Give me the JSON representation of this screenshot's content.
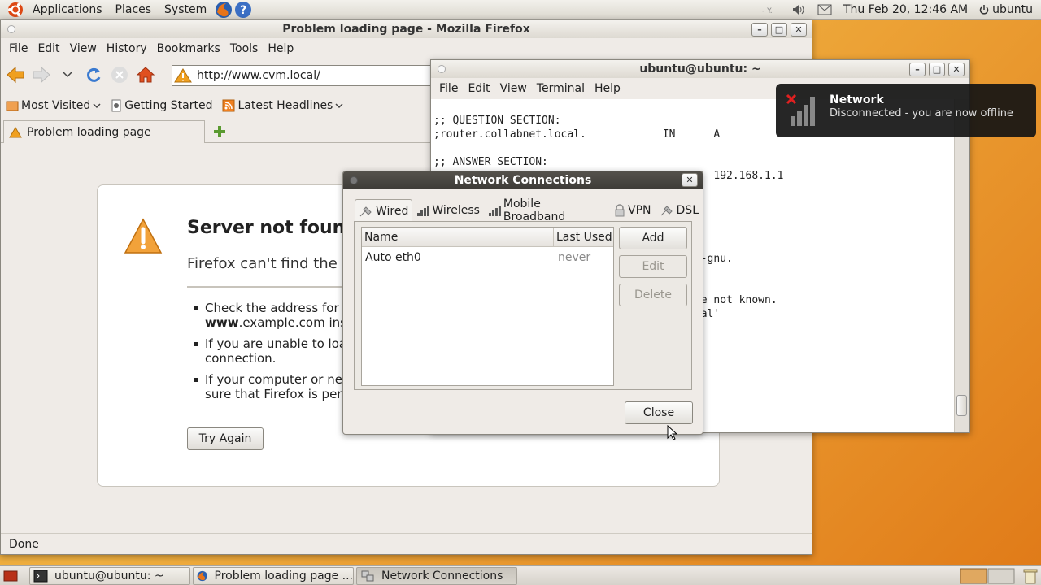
{
  "top_panel": {
    "menus": [
      "Applications",
      "Places",
      "System"
    ],
    "clock": "Thu Feb 20, 12:46 AM",
    "user": "ubuntu"
  },
  "firefox": {
    "title": "Problem loading page - Mozilla Firefox",
    "menu": [
      "File",
      "Edit",
      "View",
      "History",
      "Bookmarks",
      "Tools",
      "Help"
    ],
    "url": "http://www.cvm.local/",
    "bookmarks": [
      "Most Visited",
      "Getting Started",
      "Latest Headlines"
    ],
    "tab_title": "Problem loading page",
    "error": {
      "title": "Server not found",
      "subtitle": "Firefox can't find the server at www.cvm.local.",
      "items": [
        {
          "line1": "Check the address for typing errors such as",
          "line2_bold": "www",
          "line2": ".example.com instead of"
        },
        {
          "line1": "If you are unable to load any pages, check your computer's network",
          "line2": "connection."
        },
        {
          "line1": "If your computer or network is protected by a firewall or proxy, make",
          "line2": "sure that Firefox is permitted to access the Web."
        }
      ],
      "try_again": "Try Again"
    },
    "status": "Done"
  },
  "terminal": {
    "title": "ubuntu@ubuntu: ~",
    "menu": [
      "File",
      "Edit",
      "View",
      "Terminal",
      "Help"
    ],
    "lines": [
      ";; QUESTION SECTION:",
      ";router.collabnet.local.            IN      A",
      "",
      ";; ANSWER SECTION:",
      "                                            192.168.1.1",
      "",
      "",
      "",
      "",
      "",
      "                                        ux-gnu.",
      "",
      "",
      "                                       vice not known.",
      "                                       local'"
    ]
  },
  "network_dialog": {
    "title": "Network Connections",
    "tabs": [
      "Wired",
      "Wireless",
      "Mobile Broadband",
      "VPN",
      "DSL"
    ],
    "columns": [
      "Name",
      "Last Used"
    ],
    "rows": [
      {
        "name": "Auto eth0",
        "last_used": "never"
      }
    ],
    "buttons": {
      "add": "Add",
      "edit": "Edit",
      "delete": "Delete",
      "close": "Close"
    }
  },
  "notification": {
    "title": "Network",
    "body": "Disconnected - you are now offline"
  },
  "taskbar": {
    "items": [
      "ubuntu@ubuntu: ~",
      "Problem loading page ...",
      "Network Connections"
    ]
  },
  "colors": {
    "accent_orange": "#e8a23a",
    "warning_orange": "#f0a020",
    "notification_bg": "#141414"
  }
}
